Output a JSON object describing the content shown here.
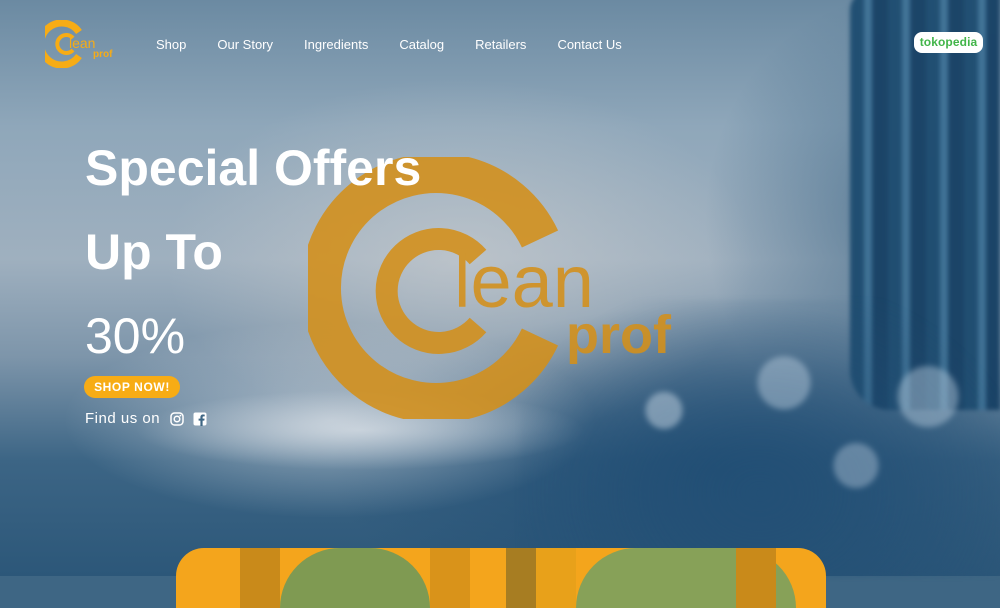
{
  "brand": {
    "name_line1": "lean",
    "name_line2": "prof",
    "color": "#f7ac15",
    "watermark_color": "#d4901a"
  },
  "nav": {
    "items": [
      {
        "label": "Shop"
      },
      {
        "label": "Our Story"
      },
      {
        "label": "Ingredients"
      },
      {
        "label": "Catalog"
      },
      {
        "label": "Retailers"
      },
      {
        "label": "Contact Us"
      }
    ],
    "marketplace_label": "tokopedia",
    "marketplace_color": "#42b549"
  },
  "hero": {
    "line1": "Special Offers",
    "line2": "Up To",
    "line3": "30%",
    "cta_label": "SHOP NOW!",
    "find_us_label": "Find us on",
    "social_icons": [
      "instagram-icon",
      "facebook-icon"
    ]
  },
  "colors": {
    "accent": "#f7ac15",
    "text": "#ffffff",
    "water_dark": "#2c5779"
  }
}
